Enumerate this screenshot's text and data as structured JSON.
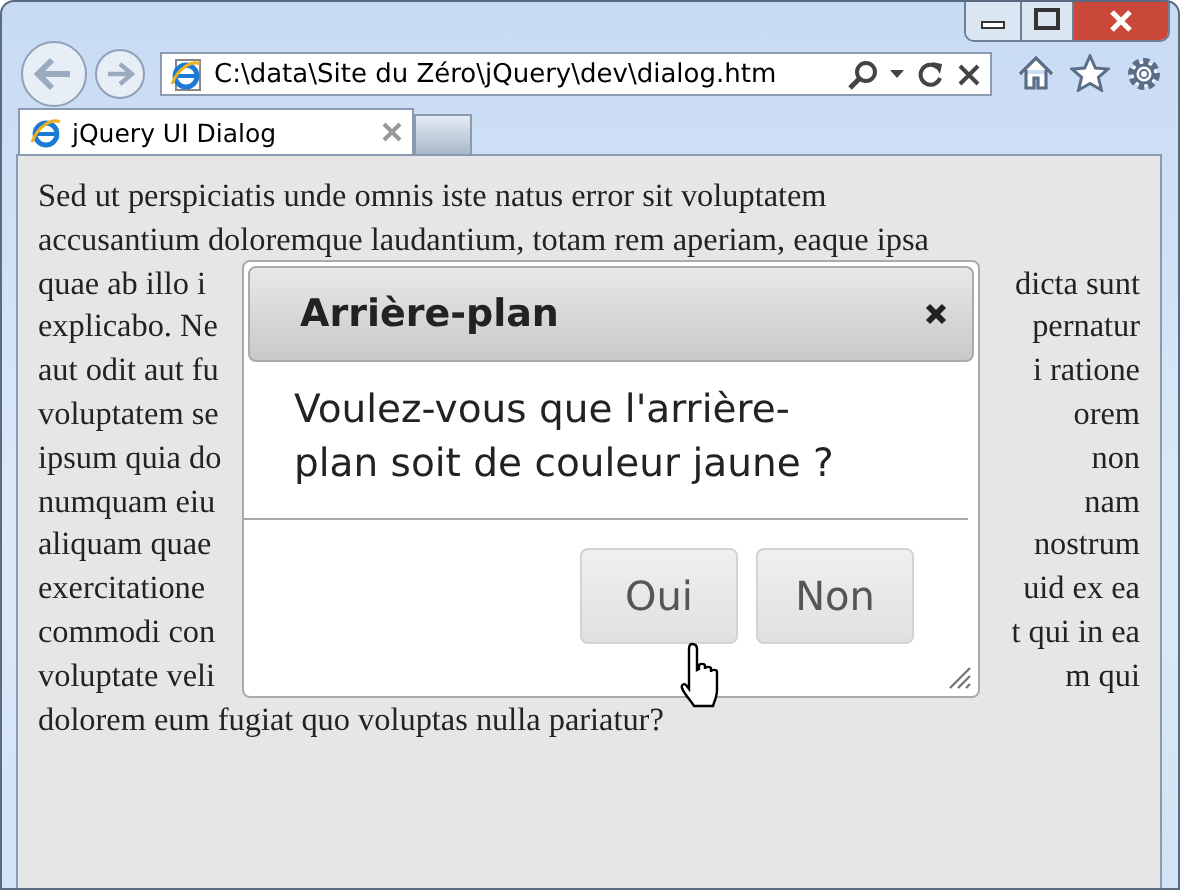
{
  "browser": {
    "address": "C:\\data\\Site du Zéro\\jQuery\\dev\\dialog.htm",
    "tabs": [
      {
        "label": "jQuery UI Dialog",
        "selected": true
      }
    ]
  },
  "page": {
    "lines": [
      {
        "kind": "full",
        "text": "Sed ut perspiciatis unde omnis iste natus error sit voluptatem"
      },
      {
        "kind": "full",
        "text": "accusantium doloremque laudantium, totam rem aperiam, eaque ipsa"
      },
      {
        "kind": "split",
        "left": "quae ab illo i",
        "right": "dicta sunt"
      },
      {
        "kind": "split",
        "left": "explicabo. Ne",
        "right": "pernatur"
      },
      {
        "kind": "split",
        "left": "aut odit aut fu",
        "right": "i ratione"
      },
      {
        "kind": "split",
        "left": "voluptatem se",
        "right": "orem"
      },
      {
        "kind": "split",
        "left": "ipsum quia do",
        "right": "non"
      },
      {
        "kind": "split",
        "left": "numquam eiu",
        "right": "nam"
      },
      {
        "kind": "split",
        "left": "aliquam quae",
        "right": "nostrum"
      },
      {
        "kind": "split",
        "left": "exercitatione",
        "right": "uid ex ea"
      },
      {
        "kind": "split",
        "left": "commodi con",
        "right": "t qui in ea"
      },
      {
        "kind": "split",
        "left": "voluptate veli",
        "right": "m qui"
      },
      {
        "kind": "full",
        "text": "dolorem eum fugiat quo voluptas nulla pariatur?"
      }
    ]
  },
  "dialog": {
    "title": "Arrière-plan",
    "message": "Voulez-vous que l'arrière-plan soit de couleur jaune ?",
    "buttons": [
      {
        "label": "Oui"
      },
      {
        "label": "Non"
      }
    ]
  }
}
